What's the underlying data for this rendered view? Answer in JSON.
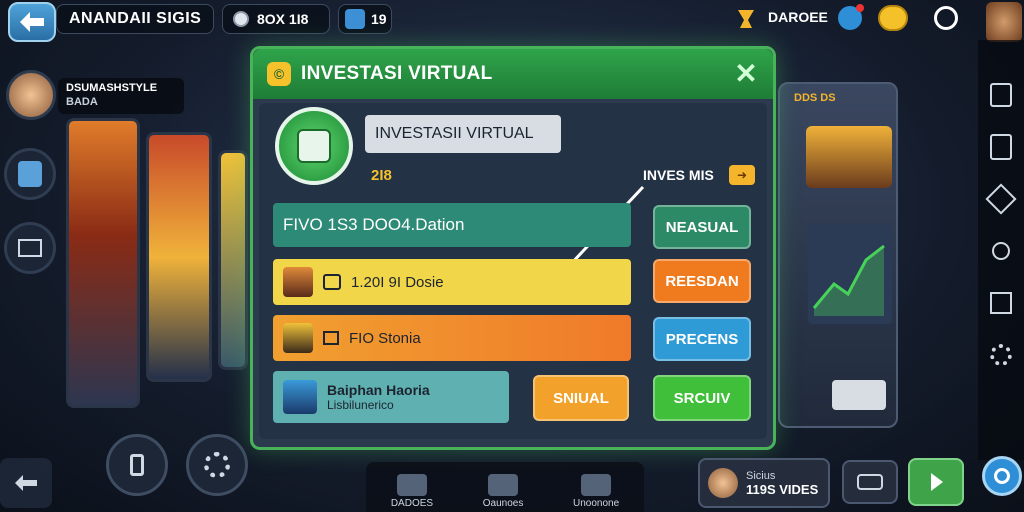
{
  "top": {
    "player_name": "ANANDAII SIGIS",
    "coins": "8OX 1I8",
    "gems": "19",
    "label": "DAROEE"
  },
  "left": {
    "name_card_line1": "DSUMASHSTYLE",
    "name_card_line2": "BADA"
  },
  "modal": {
    "title": "INVESTASI VIRTUAL",
    "feature_title": "INVESTASII VIRTUAL",
    "feature_sub": "2I8",
    "arrow_label": "INVES MIS",
    "rows": [
      {
        "text": "FIVO  1S3  DOO4.Dation",
        "action": "NEASUAL"
      },
      {
        "text": "1.20I 9I Dosie",
        "action": "REESDAN"
      },
      {
        "text": "FIO Stonia",
        "action": "PRECENS"
      }
    ],
    "last_row_line1": "Baiphan Haoria",
    "last_row_line2": "Lisbilunerico",
    "last_row_action1": "SNIUAL",
    "last_row_action2": "SRCUIV"
  },
  "right_panel": {
    "header": "DDS DS"
  },
  "bottom": {
    "tabs": [
      "DADOES",
      "Oaunoes",
      "Unoonone"
    ],
    "card_line1": "Sicius",
    "card_line2": "119S VIDES"
  },
  "colors": {
    "modal_border": "#49b35a",
    "row_teal": "#2d8a76",
    "row_yellow": "#f2d64a",
    "row_orange": "#f08a2f",
    "row_light": "#5fb0b0",
    "btn_green": "#37a34c",
    "btn_orange": "#f07b1e",
    "btn_blue": "#2f9bd6"
  }
}
